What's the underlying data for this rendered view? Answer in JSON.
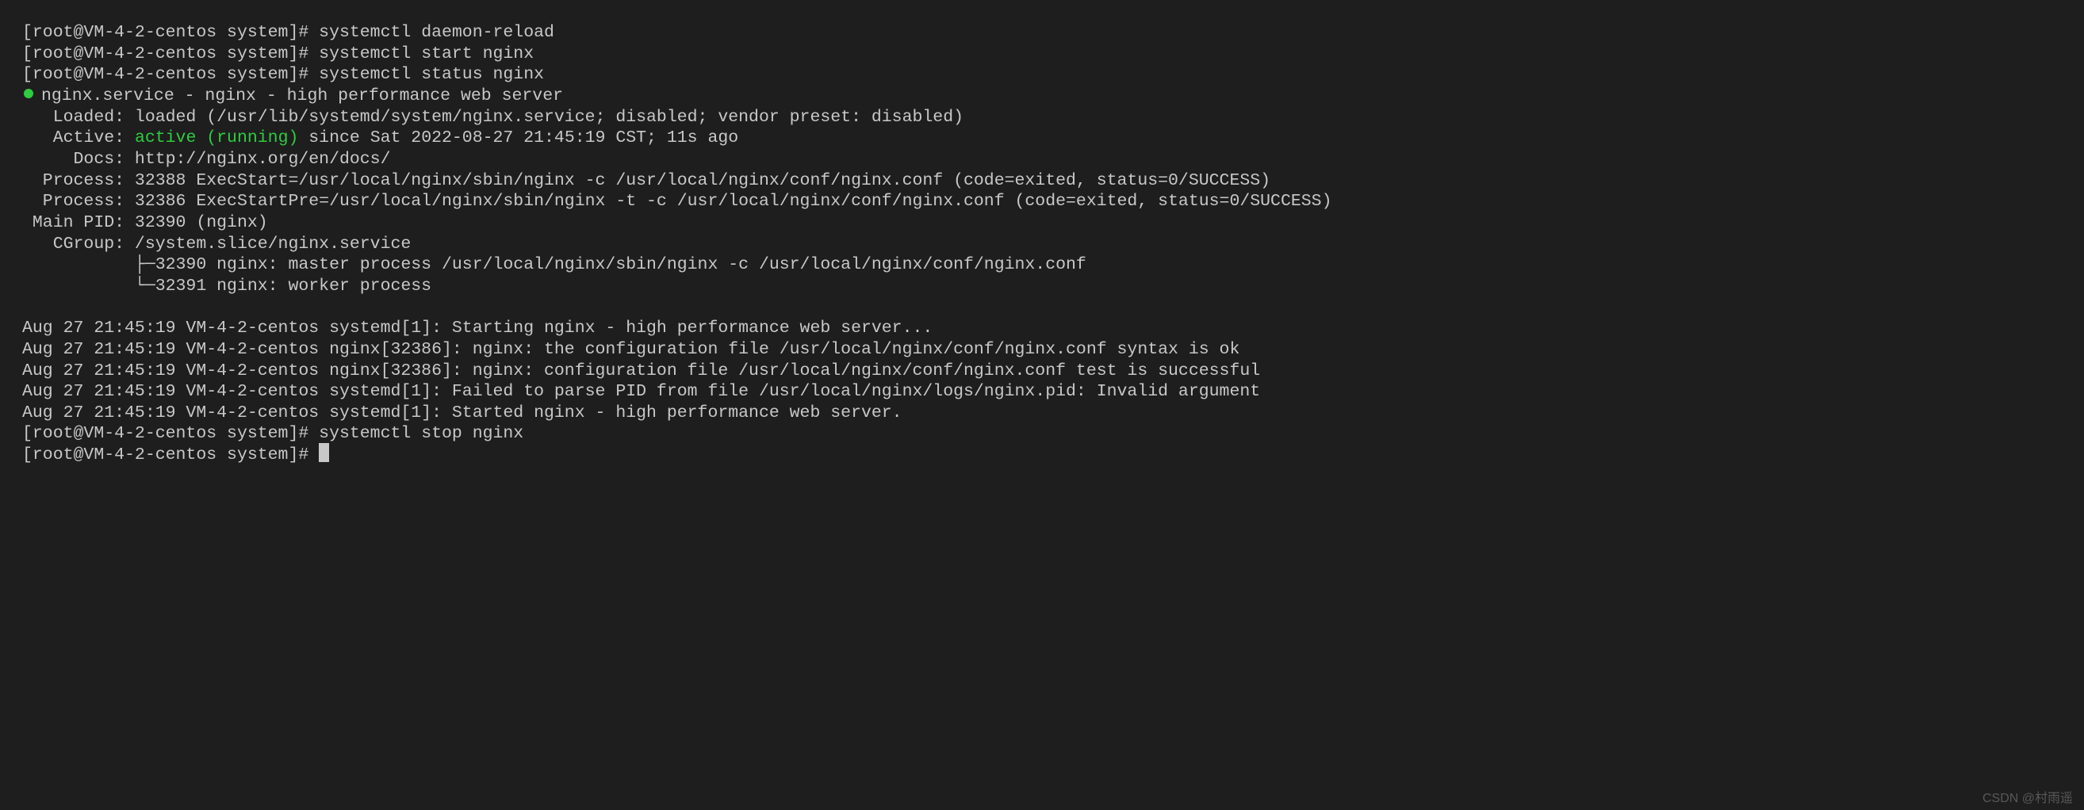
{
  "prompt": "[root@VM-4-2-centos system]# ",
  "commands": {
    "cmd1": "systemctl daemon-reload",
    "cmd2": "systemctl start nginx",
    "cmd3": "systemctl status nginx",
    "cmd4": "systemctl stop nginx",
    "cmd5": ""
  },
  "status": {
    "bulletServiceLine": "nginx.service - nginx - high performance web server",
    "loaded": "   Loaded: loaded (/usr/lib/systemd/system/nginx.service; disabled; vendor preset: disabled)",
    "activePrefix": "   Active: ",
    "activeGreen": "active (running)",
    "activeSuffix": " since Sat 2022-08-27 21:45:19 CST; 11s ago",
    "docs": "     Docs: http://nginx.org/en/docs/",
    "process1": "  Process: 32388 ExecStart=/usr/local/nginx/sbin/nginx -c /usr/local/nginx/conf/nginx.conf (code=exited, status=0/SUCCESS)",
    "process2": "  Process: 32386 ExecStartPre=/usr/local/nginx/sbin/nginx -t -c /usr/local/nginx/conf/nginx.conf (code=exited, status=0/SUCCESS)",
    "mainpid": " Main PID: 32390 (nginx)",
    "cgroup": "   CGroup: /system.slice/nginx.service",
    "tree1": "           ├─32390 nginx: master process /usr/local/nginx/sbin/nginx -c /usr/local/nginx/conf/nginx.conf",
    "tree2": "           └─32391 nginx: worker process"
  },
  "logs": {
    "l1": "Aug 27 21:45:19 VM-4-2-centos systemd[1]: Starting nginx - high performance web server...",
    "l2": "Aug 27 21:45:19 VM-4-2-centos nginx[32386]: nginx: the configuration file /usr/local/nginx/conf/nginx.conf syntax is ok",
    "l3": "Aug 27 21:45:19 VM-4-2-centos nginx[32386]: nginx: configuration file /usr/local/nginx/conf/nginx.conf test is successful",
    "l4": "Aug 27 21:45:19 VM-4-2-centos systemd[1]: Failed to parse PID from file /usr/local/nginx/logs/nginx.pid: Invalid argument",
    "l5": "Aug 27 21:45:19 VM-4-2-centos systemd[1]: Started nginx - high performance web server."
  },
  "blank": " ",
  "watermark": "CSDN @村雨遥"
}
